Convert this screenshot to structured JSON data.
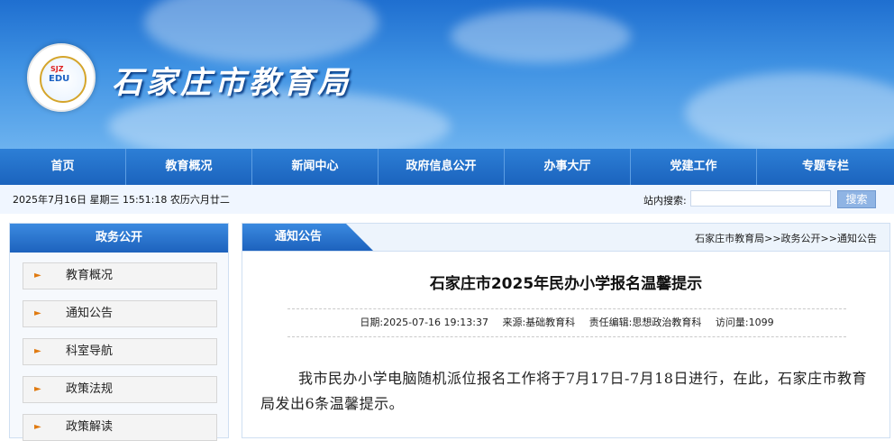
{
  "header": {
    "site_title": "石家庄市教育局",
    "logo_text": "EDU",
    "logo_sub": "SJZ"
  },
  "nav": {
    "items": [
      {
        "label": "首页"
      },
      {
        "label": "教育概况"
      },
      {
        "label": "新闻中心"
      },
      {
        "label": "政府信息公开"
      },
      {
        "label": "办事大厅"
      },
      {
        "label": "党建工作"
      },
      {
        "label": "专题专栏"
      }
    ]
  },
  "infobar": {
    "datetime": "2025年7月16日 星期三 15:51:18 农历六月廿二",
    "search_label": "站内搜索:",
    "search_value": "",
    "search_button": "搜索"
  },
  "sidebar": {
    "title": "政务公开",
    "items": [
      {
        "label": "教育概况"
      },
      {
        "label": "通知公告"
      },
      {
        "label": "科室导航"
      },
      {
        "label": "政策法规"
      },
      {
        "label": "政策解读"
      }
    ]
  },
  "main": {
    "tab_label": "通知公告",
    "breadcrumb": "石家庄市教育局>>政务公开>>通知公告",
    "article": {
      "title": "石家庄市2025年民办小学报名温馨提示",
      "date": "日期:2025-07-16 19:13:37",
      "source": "来源:基础教育科",
      "editor": "责任编辑:思想政治教育科",
      "views": "访问量:1099",
      "paragraph": "我市民办小学电脑随机派位报名工作将于7月17日-7月18日进行，在此，石家庄市教育局发出6条温馨提示。"
    }
  },
  "colors": {
    "nav_blue": "#1b63bd",
    "accent_orange": "#e07a10"
  }
}
